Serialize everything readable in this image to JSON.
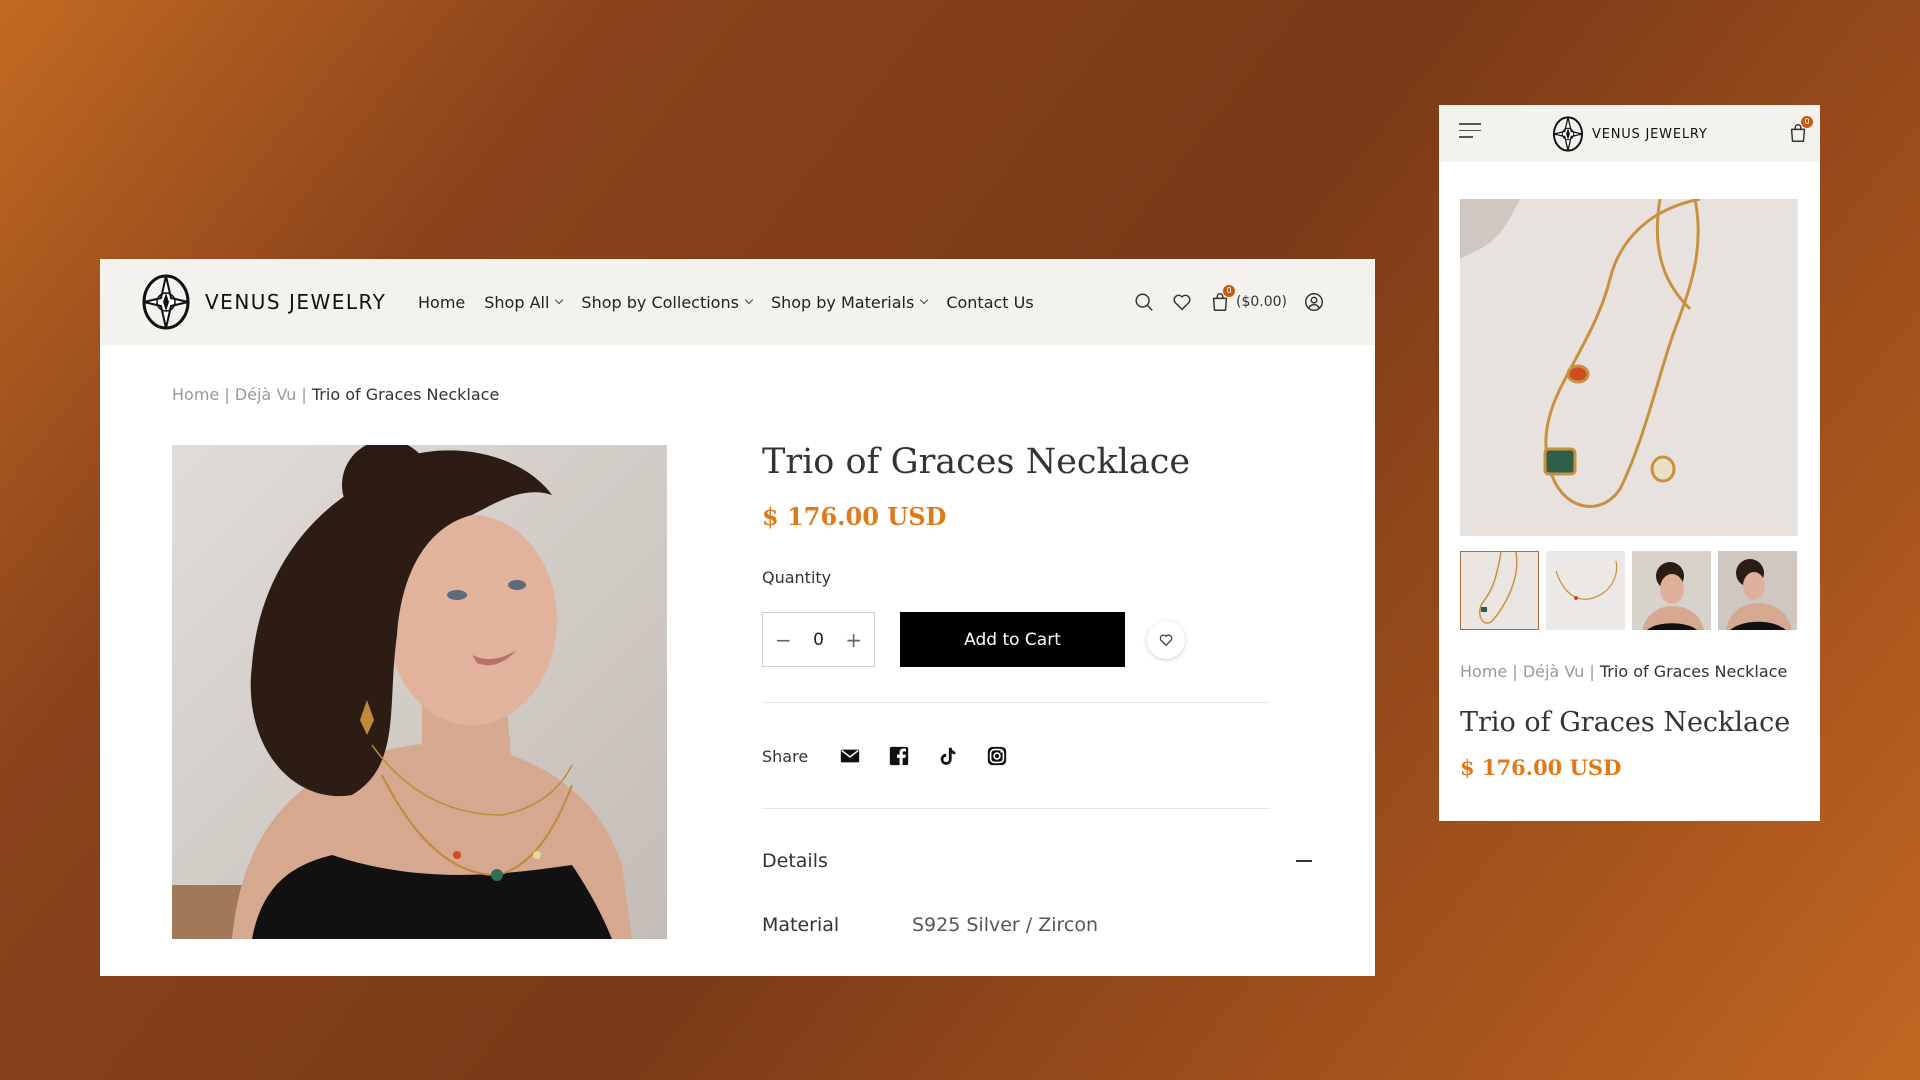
{
  "brand": {
    "name": "VENUS JEWELRY"
  },
  "nav": {
    "items": [
      {
        "label": "Home",
        "has_dropdown": false
      },
      {
        "label": "Shop All",
        "has_dropdown": true
      },
      {
        "label": "Shop by Collections",
        "has_dropdown": true
      },
      {
        "label": "Shop by Materials",
        "has_dropdown": true
      },
      {
        "label": "Contact Us",
        "has_dropdown": false
      }
    ]
  },
  "tools": {
    "search_icon": "search-icon",
    "wishlist_icon": "heart-icon",
    "cart_icon": "bag-icon",
    "cart_count": "0",
    "cart_total": "($0.00)",
    "account_icon": "user-icon"
  },
  "breadcrumb": {
    "home": "Home",
    "sep1": " | ",
    "collection": "Déjà Vu",
    "sep2": " | ",
    "current": "Trio of Graces Necklace"
  },
  "product": {
    "title": "Trio of Graces Necklace",
    "price": "$ 176.00 USD",
    "quantity_label": "Quantity",
    "quantity_value": "0",
    "add_to_cart_label": "Add to Cart",
    "share_label": "Share",
    "share_icons": [
      "mail-icon",
      "facebook-icon",
      "tiktok-icon",
      "instagram-icon"
    ],
    "details_label": "Details",
    "material_label": "Material",
    "material_value": "S925 Silver / Zircon"
  },
  "mobile": {
    "thumbnail_count": 4,
    "selected_thumbnail": 1
  },
  "colors": {
    "accent_price": "#e07a18",
    "badge": "#c85a12",
    "button_bg": "#000000",
    "header_bg": "#f4f2ef"
  }
}
